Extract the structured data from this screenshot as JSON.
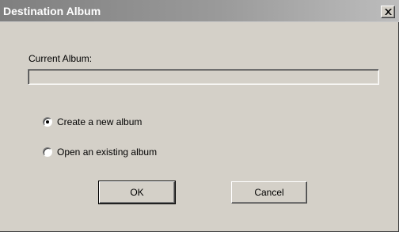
{
  "window": {
    "title": "Destination Album"
  },
  "current_album": {
    "label": "Current Album:",
    "value": ""
  },
  "options": [
    {
      "label": "Create a new album",
      "selected": true
    },
    {
      "label": "Open an existing album",
      "selected": false
    }
  ],
  "buttons": {
    "ok_label": "OK",
    "cancel_label": "Cancel"
  },
  "colors": {
    "face": "#d4d0c8",
    "title_gradient_start": "#7f7f7f",
    "title_gradient_end": "#bdbdbd"
  }
}
